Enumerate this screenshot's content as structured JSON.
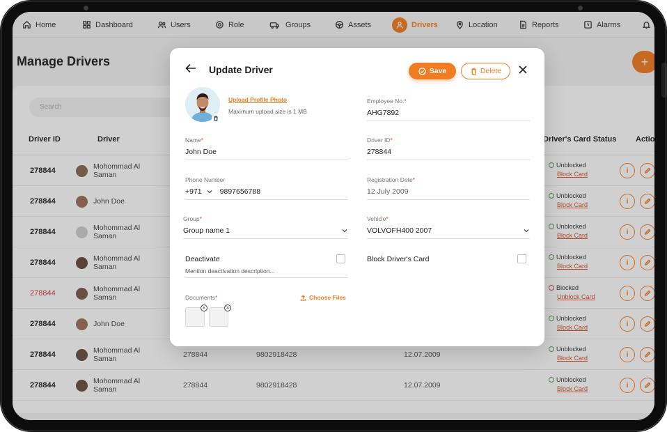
{
  "nav": {
    "items": [
      {
        "label": "Home",
        "icon": "home-icon"
      },
      {
        "label": "Dashboard",
        "icon": "dashboard-icon"
      },
      {
        "label": "Users",
        "icon": "users-icon"
      },
      {
        "label": "Role",
        "icon": "role-icon"
      },
      {
        "label": "Groups",
        "icon": "groups-icon"
      },
      {
        "label": "Assets",
        "icon": "assets-icon"
      },
      {
        "label": "Drivers",
        "icon": "driver-icon",
        "active": true
      },
      {
        "label": "Location",
        "icon": "location-pin-icon"
      },
      {
        "label": "Reports",
        "icon": "reports-icon"
      },
      {
        "label": "Alarms",
        "icon": "alarm-clock-icon"
      }
    ],
    "bell_icon": "bell-icon"
  },
  "page": {
    "title": "Manage Drivers",
    "add_label": "+",
    "search_placeholder": "Search"
  },
  "table": {
    "headers": {
      "driver_id": "Driver ID",
      "driver": "Driver",
      "card_status": "Driver's Card Status",
      "actions": "Actions"
    },
    "rows": [
      {
        "id": "278844",
        "name": "Mohommad Al Saman",
        "status": "Unblocked",
        "action": "Block Card"
      },
      {
        "id": "278844",
        "name": "John Doe",
        "status": "Unblocked",
        "action": "Block Card"
      },
      {
        "id": "278844",
        "name": "Mohommad Al Saman",
        "status": "Unblocked",
        "action": "Block Card"
      },
      {
        "id": "278844",
        "name": "Mohommad Al Saman",
        "status": "Unblocked",
        "action": "Block Card"
      },
      {
        "id": "278844",
        "name": "Mohommad Al Saman",
        "status": "Blocked",
        "action": "Unblock Card",
        "highlight": true
      },
      {
        "id": "278844",
        "name": "John Doe",
        "status": "Unblocked",
        "action": "Block Card"
      },
      {
        "id": "278844",
        "name": "Mohommad Al Saman",
        "employee_no": "278844",
        "phone": "9802918428",
        "date": "12.07.2009",
        "status": "Unblocked",
        "action": "Block Card"
      },
      {
        "id": "278844",
        "name": "Mohommad Al Saman",
        "employee_no": "278844",
        "phone": "9802918428",
        "date": "12.07.2009",
        "status": "Unblocked",
        "action": "Block Card"
      }
    ]
  },
  "modal": {
    "title": "Update Driver",
    "save_label": "Save",
    "delete_label": "Delete",
    "upload_link": "Upload Profile Photo",
    "upload_note": "Maximum upload size is 1 MB",
    "fields": {
      "employee_no": {
        "label": "Employee No.",
        "value": "AHG7892"
      },
      "name": {
        "label": "Name",
        "value": "John Doe"
      },
      "driver_id": {
        "label": "Driver ID",
        "value": "278844"
      },
      "phone": {
        "label": "Phone Number",
        "code": "+971",
        "value": "9897656788"
      },
      "registration_date": {
        "label": "Registration Date",
        "value": "12 July 2009"
      },
      "group": {
        "label": "Group",
        "value": "Group name 1"
      },
      "vehicle": {
        "label": "Vehicle",
        "value": "VOLVOFH400 2007"
      }
    },
    "deactivate_label": "Deactivate",
    "deactivate_placeholder": "Mention deactivation description...",
    "block_card_label": "Block Driver's Card",
    "documents_label": "Documents",
    "choose_files_label": "Choose Files"
  },
  "colors": {
    "accent": "#f27c22",
    "danger": "#d0433b",
    "success": "#4aa44a"
  }
}
